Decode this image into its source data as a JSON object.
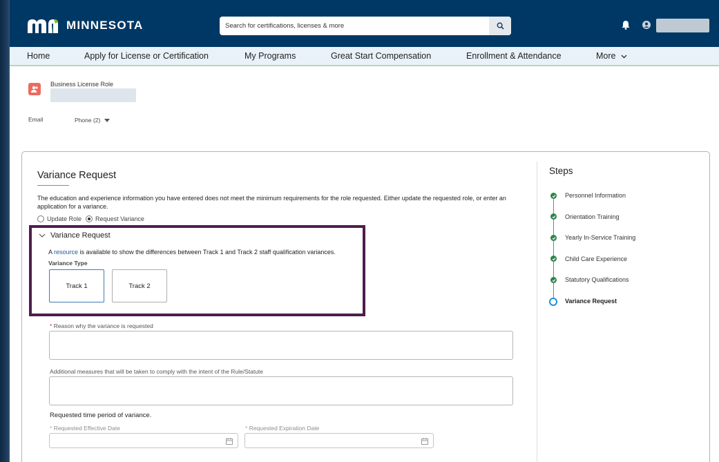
{
  "header": {
    "brand": "MINNESOTA",
    "search_placeholder": "Search for certifications, licenses & more"
  },
  "nav": {
    "items": [
      "Home",
      "Apply for License or Certification",
      "My Programs",
      "Great Start Compensation",
      "Enrollment & Attendance"
    ],
    "more": "More"
  },
  "profile": {
    "role_label": "Business License Role",
    "email_label": "Email",
    "phone_label": "Phone (2)"
  },
  "form": {
    "title": "Variance Request",
    "description": "The education and experience information you have entered does not meet the minimum requirements for the role requested. Either update the requested role, or enter an application for a variance.",
    "radio_update": "Update Role",
    "radio_request": "Request Variance",
    "section_title": "Variance Request",
    "resource_prefix": "A ",
    "resource_link": "resource",
    "resource_suffix": " is available to show the differences between Track 1 and Track 2 staff qualification variances.",
    "variance_type_label": "Variance Type",
    "track1": "Track 1",
    "track2": "Track 2",
    "reason_label": "Reason why the variance is requested",
    "measures_label": "Additional measures that will be taken to comply with the intent of the Rule/Statute",
    "period_label": "Requested time period of variance.",
    "effective_label": "Requested Effective Date",
    "expiration_label": "Requested Expiration Date",
    "required_marker": "*"
  },
  "steps": {
    "title": "Steps",
    "items": [
      "Personnel Information",
      "Orientation Training",
      "Yearly In-Service Training",
      "Child Care Experience",
      "Statutory Qualifications",
      "Variance Request"
    ]
  },
  "colors": {
    "header_bg": "#003865",
    "nav_bg": "#e8f2f8",
    "highlight_border": "#4d1e4d",
    "step_complete": "#2e844a",
    "step_active": "#1f8fdd",
    "link": "#1f5b97"
  }
}
